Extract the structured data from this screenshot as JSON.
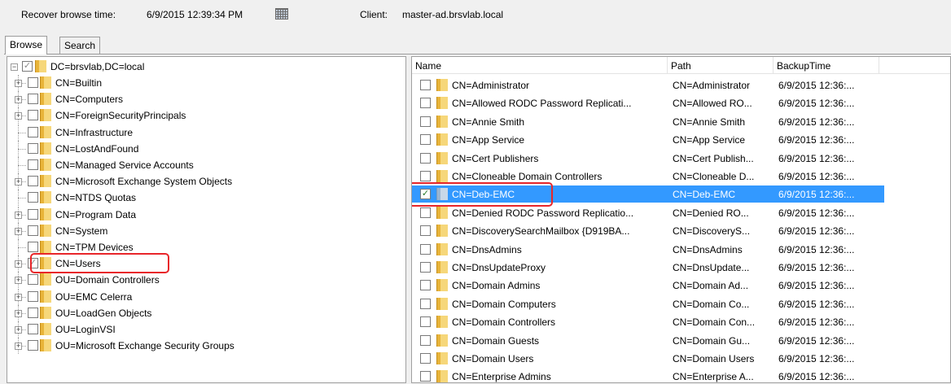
{
  "header": {
    "recover_label": "Recover browse time:",
    "recover_value": "6/9/2015 12:39:34 PM",
    "client_label": "Client:",
    "client_value": "master-ad.brsvlab.local"
  },
  "tabs": [
    {
      "label": "Browse",
      "active": true
    },
    {
      "label": "Search",
      "active": false
    }
  ],
  "tree": {
    "root": {
      "label": "DC=brsvlab,DC=local",
      "expanded": true,
      "checked": "partial"
    },
    "items": [
      {
        "label": "CN=Builtin",
        "expandable": true,
        "checked": false
      },
      {
        "label": "CN=Computers",
        "expandable": true,
        "checked": false
      },
      {
        "label": "CN=ForeignSecurityPrincipals",
        "expandable": true,
        "checked": false
      },
      {
        "label": "CN=Infrastructure",
        "expandable": false,
        "checked": false
      },
      {
        "label": "CN=LostAndFound",
        "expandable": false,
        "checked": false
      },
      {
        "label": "CN=Managed Service Accounts",
        "expandable": false,
        "checked": false
      },
      {
        "label": "CN=Microsoft Exchange System Objects",
        "expandable": true,
        "checked": false
      },
      {
        "label": "CN=NTDS Quotas",
        "expandable": false,
        "checked": false
      },
      {
        "label": "CN=Program Data",
        "expandable": true,
        "checked": false
      },
      {
        "label": "CN=System",
        "expandable": true,
        "checked": false
      },
      {
        "label": "CN=TPM Devices",
        "expandable": false,
        "checked": false
      },
      {
        "label": "CN=Users",
        "expandable": true,
        "checked": "partial",
        "highlighted": true
      },
      {
        "label": "OU=Domain Controllers",
        "expandable": true,
        "checked": false
      },
      {
        "label": "OU=EMC Celerra",
        "expandable": true,
        "checked": false
      },
      {
        "label": "OU=LoadGen Objects",
        "expandable": true,
        "checked": false
      },
      {
        "label": "OU=LoginVSI",
        "expandable": true,
        "checked": false
      },
      {
        "label": "OU=Microsoft Exchange Security Groups",
        "expandable": true,
        "checked": false
      }
    ]
  },
  "list": {
    "columns": [
      "Name",
      "Path",
      "BackupTime"
    ],
    "rows": [
      {
        "name": "CN=Administrator",
        "path": "CN=Administrator",
        "time": "6/9/2015 12:36:...",
        "checked": false
      },
      {
        "name": "CN=Allowed RODC Password Replicati...",
        "path": "CN=Allowed RO...",
        "time": "6/9/2015 12:36:...",
        "checked": false
      },
      {
        "name": "CN=Annie Smith",
        "path": "CN=Annie Smith",
        "time": "6/9/2015 12:36:...",
        "checked": false
      },
      {
        "name": "CN=App Service",
        "path": "CN=App Service",
        "time": "6/9/2015 12:36:...",
        "checked": false
      },
      {
        "name": "CN=Cert Publishers",
        "path": "CN=Cert Publish...",
        "time": "6/9/2015 12:36:...",
        "checked": false
      },
      {
        "name": "CN=Cloneable Domain Controllers",
        "path": "CN=Cloneable D...",
        "time": "6/9/2015 12:36:...",
        "checked": false
      },
      {
        "name": "CN=Deb-EMC",
        "path": "CN=Deb-EMC",
        "time": "6/9/2015 12:36:...",
        "checked": true,
        "selected": true
      },
      {
        "name": "CN=Denied RODC Password Replicatio...",
        "path": "CN=Denied RO...",
        "time": "6/9/2015 12:36:...",
        "checked": false
      },
      {
        "name": "CN=DiscoverySearchMailbox {D919BA...",
        "path": "CN=DiscoveryS...",
        "time": "6/9/2015 12:36:...",
        "checked": false
      },
      {
        "name": "CN=DnsAdmins",
        "path": "CN=DnsAdmins",
        "time": "6/9/2015 12:36:...",
        "checked": false
      },
      {
        "name": "CN=DnsUpdateProxy",
        "path": "CN=DnsUpdate...",
        "time": "6/9/2015 12:36:...",
        "checked": false
      },
      {
        "name": "CN=Domain Admins",
        "path": "CN=Domain Ad...",
        "time": "6/9/2015 12:36:...",
        "checked": false
      },
      {
        "name": "CN=Domain Computers",
        "path": "CN=Domain Co...",
        "time": "6/9/2015 12:36:...",
        "checked": false
      },
      {
        "name": "CN=Domain Controllers",
        "path": "CN=Domain Con...",
        "time": "6/9/2015 12:36:...",
        "checked": false
      },
      {
        "name": "CN=Domain Guests",
        "path": "CN=Domain Gu...",
        "time": "6/9/2015 12:36:...",
        "checked": false
      },
      {
        "name": "CN=Domain Users",
        "path": "CN=Domain Users",
        "time": "6/9/2015 12:36:...",
        "checked": false
      },
      {
        "name": "CN=Enterprise Admins",
        "path": "CN=Enterprise A...",
        "time": "6/9/2015 12:36:...",
        "checked": false
      }
    ]
  },
  "colors": {
    "selection": "#3399ff",
    "annotation": "#e8262a"
  }
}
